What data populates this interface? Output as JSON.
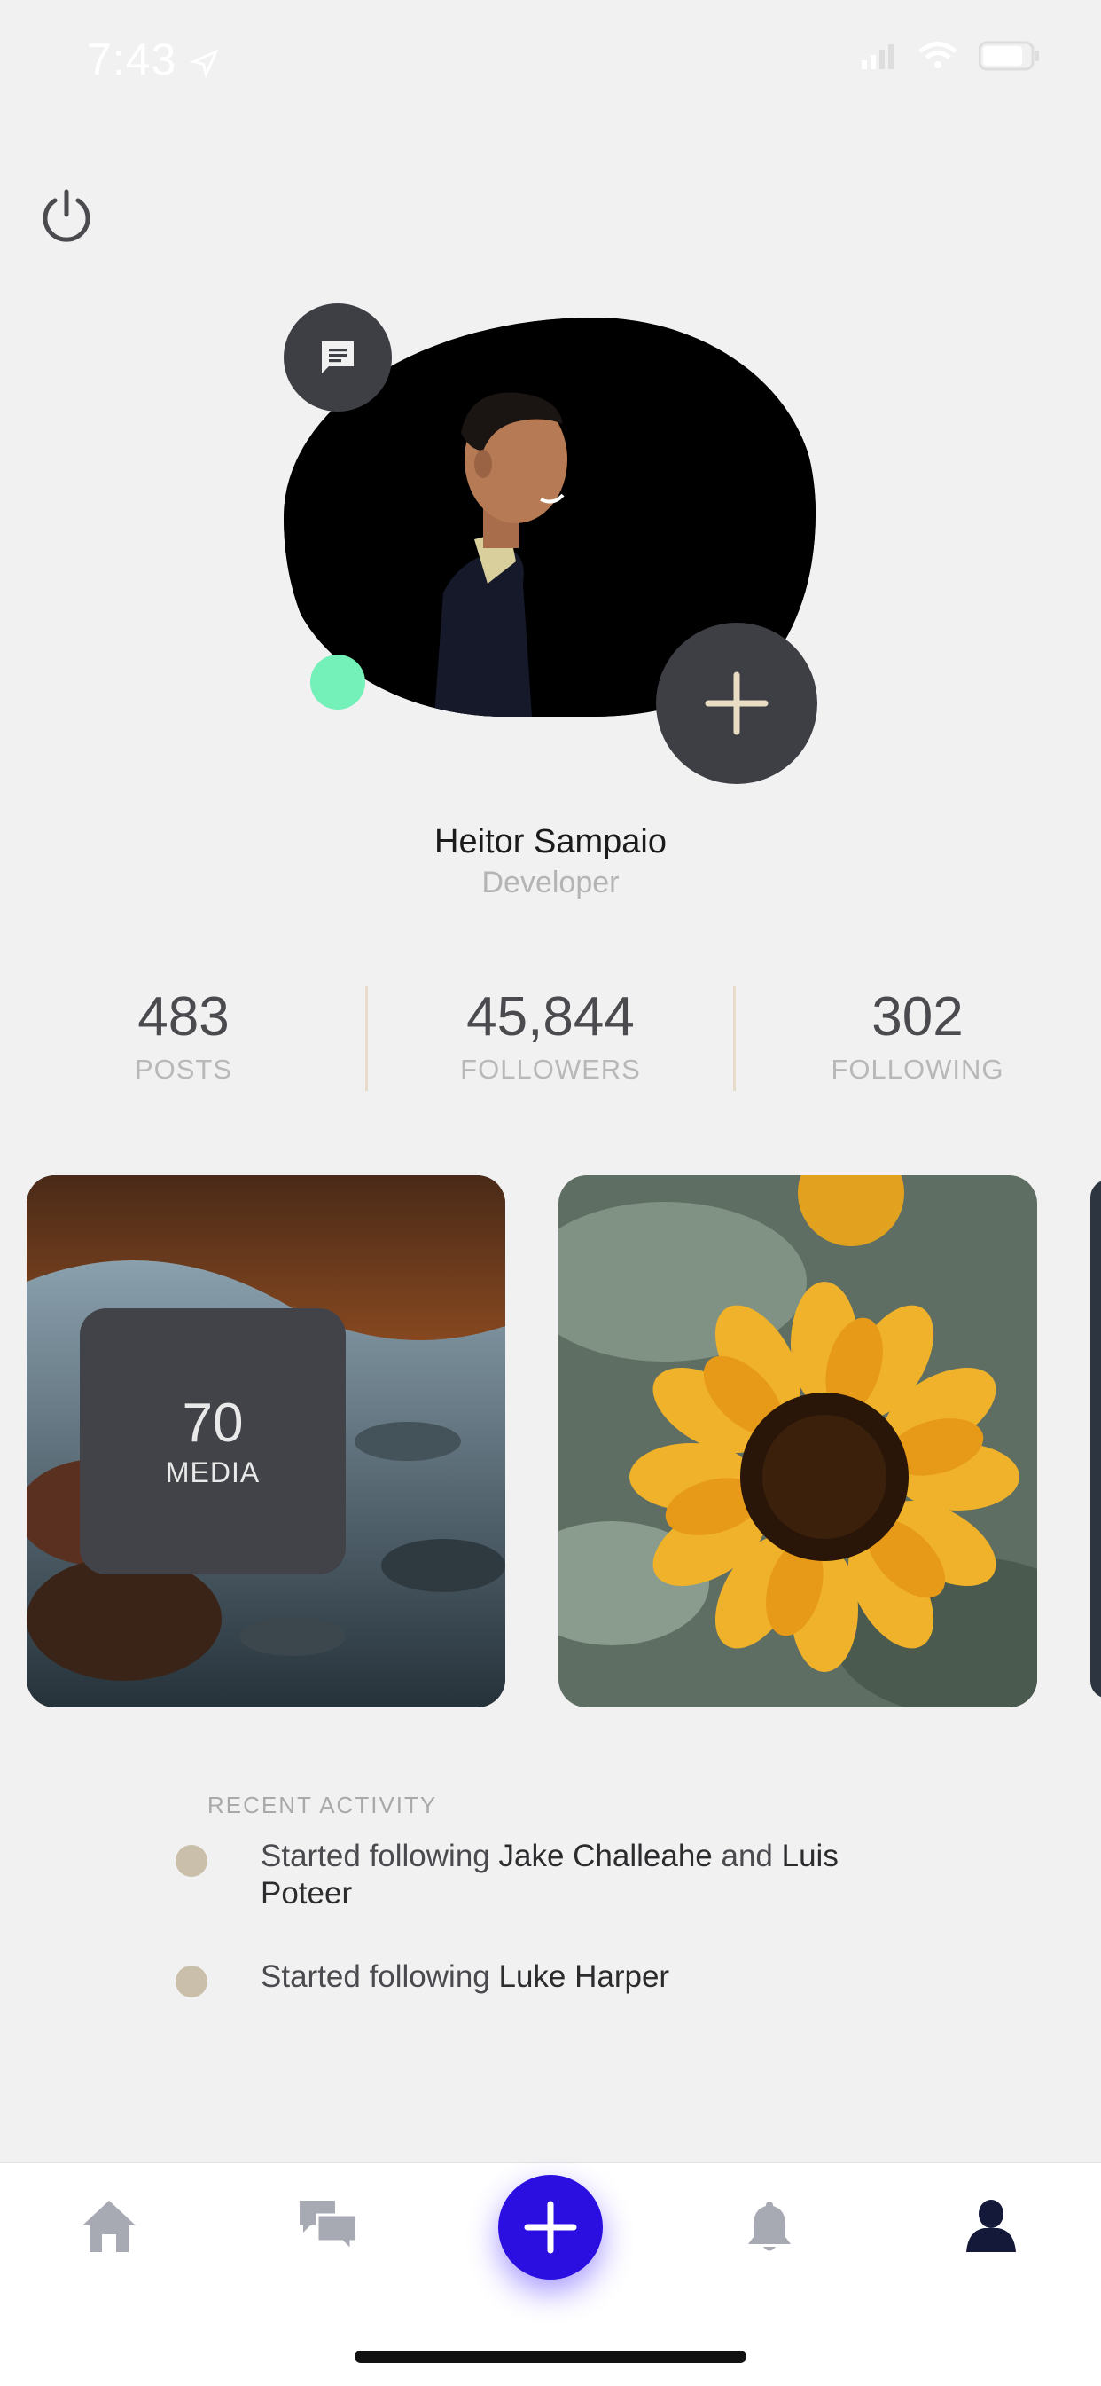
{
  "status_bar": {
    "time": "7:43"
  },
  "profile": {
    "name": "Heitor Sampaio",
    "role": "Developer"
  },
  "stats": [
    {
      "value": "483",
      "label": "POSTS"
    },
    {
      "value": "45,844",
      "label": "FOLLOWERS"
    },
    {
      "value": "302",
      "label": "FOLLOWING"
    }
  ],
  "media": {
    "count": "70",
    "label": "MEDIA"
  },
  "activity": {
    "title": "RECENT ACTIVITY",
    "items": [
      {
        "prefix": "Started following ",
        "name1": "Jake Challeahe",
        "joiner": " and ",
        "name2": "Luis Poteer"
      },
      {
        "prefix": "Started following ",
        "name1": "Luke Harper"
      }
    ]
  },
  "tabs": [
    "home-icon",
    "chat-icon",
    "add-icon",
    "bell-icon",
    "profile-icon"
  ],
  "colors": {
    "accent": "#2a0fe0",
    "online": "#74f0b9",
    "dark": "#3e3f45"
  }
}
